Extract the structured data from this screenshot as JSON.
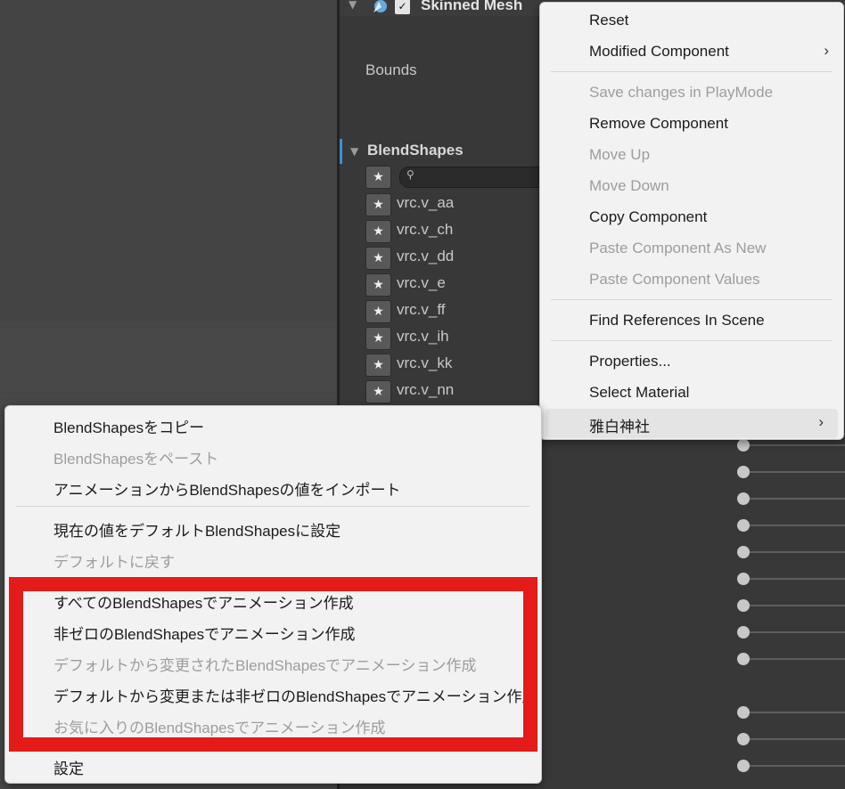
{
  "inspector": {
    "component_title": "Skinned Mesh",
    "bounds_label": "Bounds",
    "blendshapes_title": "BlendShapes",
    "blendshape_items": [
      "vrc.v_aa",
      "vrc.v_ch",
      "vrc.v_dd",
      "vrc.v_e",
      "vrc.v_ff",
      "vrc.v_ih",
      "vrc.v_kk",
      "vrc.v_nn"
    ],
    "star_glyph": "★",
    "checkbox_glyph": "✓"
  },
  "component_menu": {
    "items": [
      {
        "label": "Reset",
        "disabled": false
      },
      {
        "label": "Modified Component",
        "disabled": false,
        "submenu": true
      },
      {
        "label": "Save changes in PlayMode",
        "disabled": true
      },
      {
        "label": "Remove Component",
        "disabled": false
      },
      {
        "label": "Move Up",
        "disabled": true
      },
      {
        "label": "Move Down",
        "disabled": true
      },
      {
        "label": "Copy Component",
        "disabled": false
      },
      {
        "label": "Paste Component As New",
        "disabled": true
      },
      {
        "label": "Paste Component Values",
        "disabled": true
      },
      {
        "label": "Find References In Scene",
        "disabled": false
      },
      {
        "label": "Properties...",
        "disabled": false
      },
      {
        "label": "Select Material",
        "disabled": false
      },
      {
        "label": "雅白神社",
        "disabled": false,
        "submenu": true,
        "highlighted": true
      }
    ],
    "submenu_arrow": "›"
  },
  "blendshape_menu": {
    "items": [
      {
        "label": "BlendShapesをコピー",
        "disabled": false
      },
      {
        "label": "BlendShapesをペースト",
        "disabled": true
      },
      {
        "label": "アニメーションからBlendShapesの値をインポート",
        "disabled": false
      },
      {
        "label": "現在の値をデフォルトBlendShapesに設定",
        "disabled": false
      },
      {
        "label": "デフォルトに戻す",
        "disabled": true
      },
      {
        "label": "すべてのBlendShapesでアニメーション作成",
        "disabled": false
      },
      {
        "label": "非ゼロのBlendShapesでアニメーション作成",
        "disabled": false
      },
      {
        "label": "デフォルトから変更されたBlendShapesでアニメーション作成",
        "disabled": true
      },
      {
        "label": "デフォルトから変更または非ゼロのBlendShapesでアニメーション作成",
        "disabled": false
      },
      {
        "label": "お気に入りのBlendShapesでアニメーション作成",
        "disabled": true
      },
      {
        "label": "設定",
        "disabled": false
      }
    ]
  },
  "colors": {
    "highlight_box": "#e41b1b",
    "accent": "#3d8fd6",
    "menu_bg": "#f2f2f2",
    "disabled_text": "#9d9d9d"
  }
}
